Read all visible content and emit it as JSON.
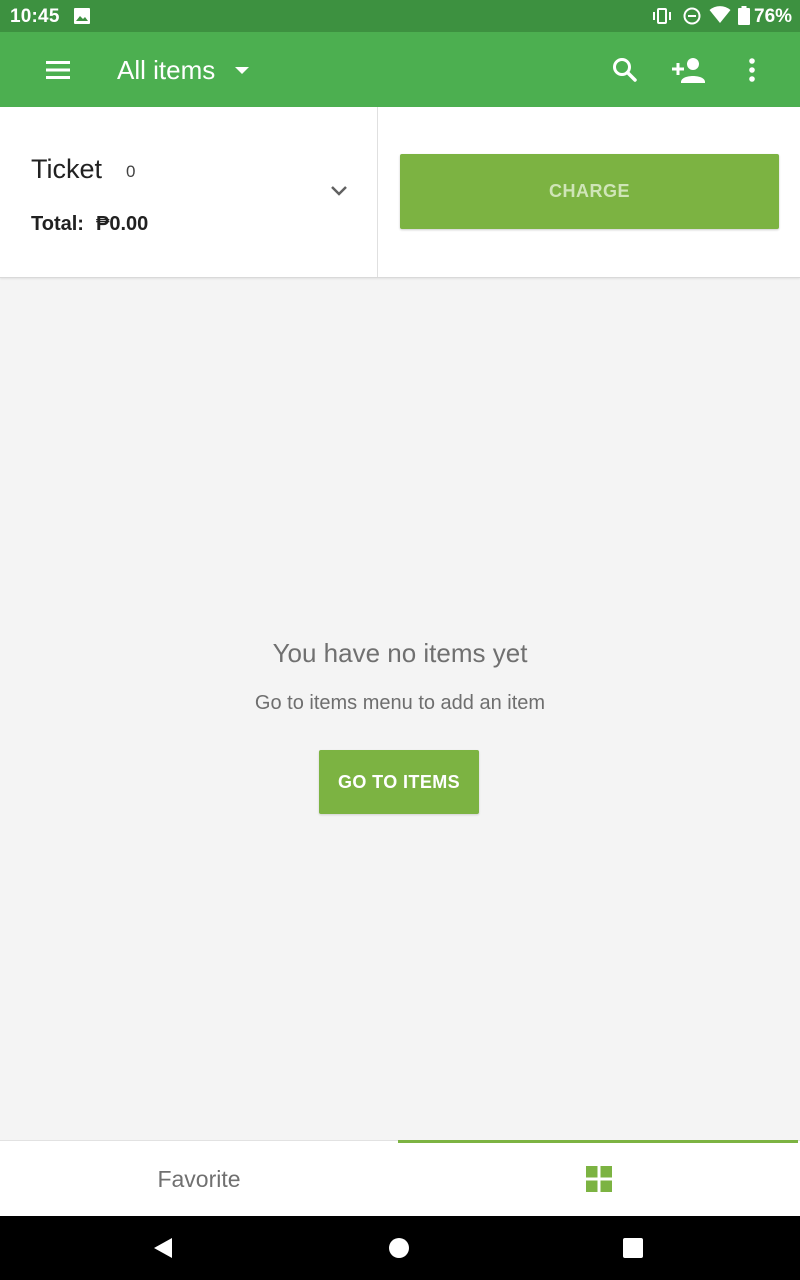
{
  "status_bar": {
    "time": "10:45",
    "battery": "76%"
  },
  "app_bar": {
    "title": "All items",
    "icons": [
      "menu-icon",
      "search-icon",
      "add-customer-icon",
      "more-vert-icon"
    ]
  },
  "ticket": {
    "title": "Ticket",
    "count": "0",
    "total_label": "Total:",
    "total_value": "₱0.00",
    "charge_label": "CHARGE"
  },
  "empty_state": {
    "title": "You have no items yet",
    "subtitle": "Go to items menu to add an item",
    "button_label": "GO TO ITEMS"
  },
  "bottom_tabs": {
    "favorite_label": "Favorite",
    "active_tab": "grid"
  },
  "colors": {
    "status_bar": "#3d9140",
    "app_bar": "#4caf50",
    "accent": "#7cb342",
    "background": "#f4f4f4"
  }
}
